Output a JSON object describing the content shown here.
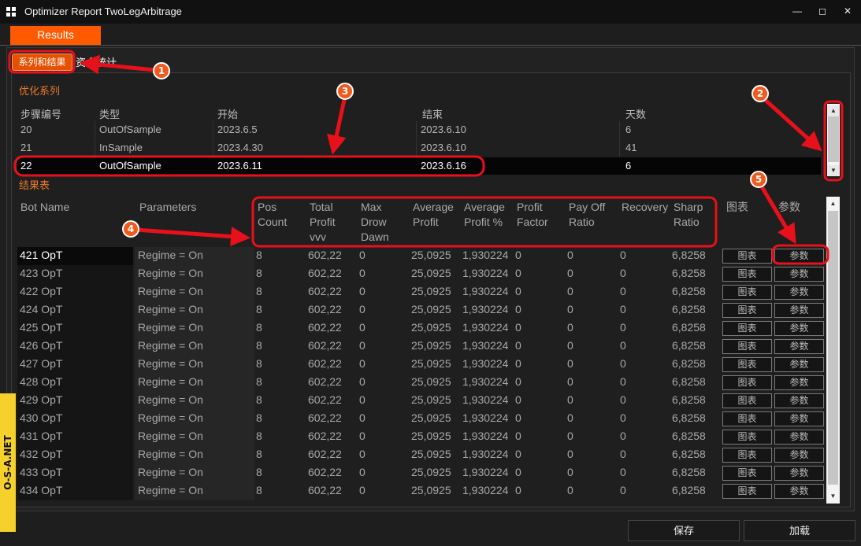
{
  "window": {
    "title": "Optimizer Report  TwoLegArbitrage",
    "min_glyph": "—",
    "max_glyph": "◻",
    "close_glyph": "✕"
  },
  "tabs": {
    "results": "Results"
  },
  "subtabs": {
    "active": "系列和结果",
    "second": "资金统计"
  },
  "series_section": {
    "label": "优化系列",
    "columns": [
      "步骤编号",
      "类型",
      "开始",
      "结束",
      "天数"
    ],
    "rows": [
      [
        "20",
        "OutOfSample",
        "2023.6.5",
        "2023.6.10",
        "6"
      ],
      [
        "21",
        "InSample",
        "2023.4.30",
        "2023.6.10",
        "41"
      ],
      [
        "22",
        "OutOfSample",
        "2023.6.11",
        "2023.6.16",
        "6"
      ]
    ]
  },
  "results_section": {
    "label": "结果表",
    "columns": [
      "Bot Name",
      "Parameters",
      "Pos\nCount",
      "Total\nProfit\nvvv",
      "Max\nDrow\nDawn",
      "Average\nProfit",
      "Average\nProfit %",
      "Profit\nFactor",
      "Pay Off\nRatio",
      "Recovery",
      "Sharp\nRatio",
      "图表",
      "参数"
    ],
    "chart_button_label": "图表",
    "params_button_label": "参数",
    "rows": [
      [
        "421 OpT",
        "Regime = On",
        "8",
        "602,22",
        "0",
        "25,0925",
        "1,930224",
        "0",
        "0",
        "0",
        "6,8258"
      ],
      [
        "423 OpT",
        "Regime = On",
        "8",
        "602,22",
        "0",
        "25,0925",
        "1,930224",
        "0",
        "0",
        "0",
        "6,8258"
      ],
      [
        "422 OpT",
        "Regime = On",
        "8",
        "602,22",
        "0",
        "25,0925",
        "1,930224",
        "0",
        "0",
        "0",
        "6,8258"
      ],
      [
        "424 OpT",
        "Regime = On",
        "8",
        "602,22",
        "0",
        "25,0925",
        "1,930224",
        "0",
        "0",
        "0",
        "6,8258"
      ],
      [
        "425 OpT",
        "Regime = On",
        "8",
        "602,22",
        "0",
        "25,0925",
        "1,930224",
        "0",
        "0",
        "0",
        "6,8258"
      ],
      [
        "426 OpT",
        "Regime = On",
        "8",
        "602,22",
        "0",
        "25,0925",
        "1,930224",
        "0",
        "0",
        "0",
        "6,8258"
      ],
      [
        "427 OpT",
        "Regime = On",
        "8",
        "602,22",
        "0",
        "25,0925",
        "1,930224",
        "0",
        "0",
        "0",
        "6,8258"
      ],
      [
        "428 OpT",
        "Regime = On",
        "8",
        "602,22",
        "0",
        "25,0925",
        "1,930224",
        "0",
        "0",
        "0",
        "6,8258"
      ],
      [
        "429 OpT",
        "Regime = On",
        "8",
        "602,22",
        "0",
        "25,0925",
        "1,930224",
        "0",
        "0",
        "0",
        "6,8258"
      ],
      [
        "430 OpT",
        "Regime = On",
        "8",
        "602,22",
        "0",
        "25,0925",
        "1,930224",
        "0",
        "0",
        "0",
        "6,8258"
      ],
      [
        "431 OpT",
        "Regime = On",
        "8",
        "602,22",
        "0",
        "25,0925",
        "1,930224",
        "0",
        "0",
        "0",
        "6,8258"
      ],
      [
        "432 OpT",
        "Regime = On",
        "8",
        "602,22",
        "0",
        "25,0925",
        "1,930224",
        "0",
        "0",
        "0",
        "6,8258"
      ],
      [
        "433 OpT",
        "Regime = On",
        "8",
        "602,22",
        "0",
        "25,0925",
        "1,930224",
        "0",
        "0",
        "0",
        "6,8258"
      ],
      [
        "434 OpT",
        "Regime = On",
        "8",
        "602,22",
        "0",
        "25,0925",
        "1,930224",
        "0",
        "0",
        "0",
        "6,8258"
      ]
    ]
  },
  "footer": {
    "save": "保存",
    "load": "加载"
  },
  "watermark": "O-S-A.NET",
  "annotations": [
    "1",
    "2",
    "3",
    "4",
    "5"
  ],
  "colors": {
    "accent": "#ff5a00",
    "section_label": "#e8792e",
    "annotation_red": "#e8101a",
    "badge_yellow": "#f7d12b"
  }
}
